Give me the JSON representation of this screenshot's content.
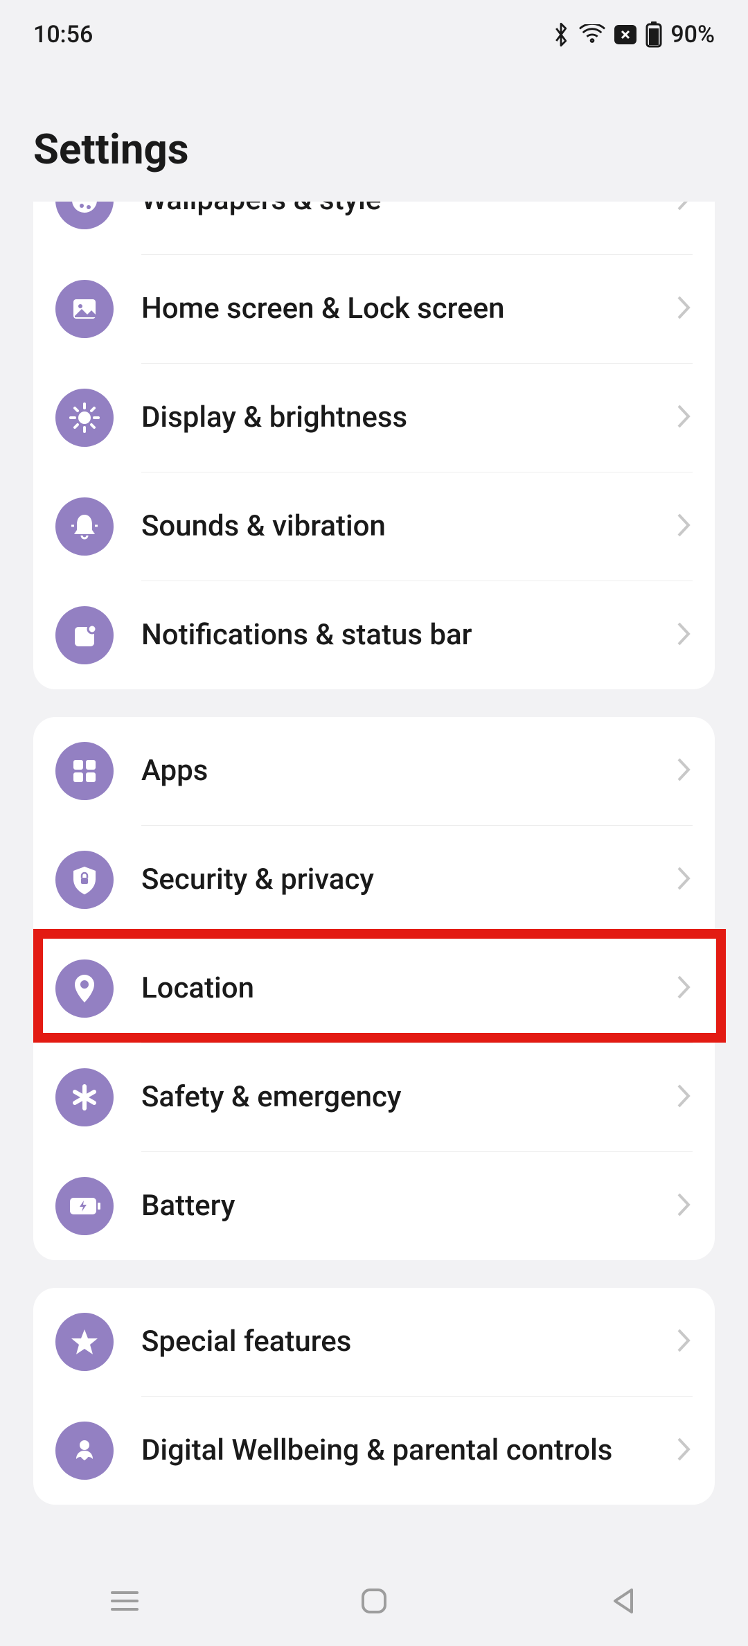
{
  "status": {
    "time": "10:56",
    "battery_text": "90%"
  },
  "header": {
    "title": "Settings"
  },
  "groups": [
    {
      "items": [
        {
          "id": "wallpapers",
          "label": "Wallpapers & style",
          "icon": "palette"
        },
        {
          "id": "home-lock",
          "label": "Home screen & Lock screen",
          "icon": "image"
        },
        {
          "id": "display",
          "label": "Display & brightness",
          "icon": "sun"
        },
        {
          "id": "sounds",
          "label": "Sounds & vibration",
          "icon": "bell"
        },
        {
          "id": "notifications",
          "label": "Notifications & status bar",
          "icon": "notif"
        }
      ]
    },
    {
      "items": [
        {
          "id": "apps",
          "label": "Apps",
          "icon": "grid",
          "highlighted": true
        },
        {
          "id": "security",
          "label": "Security & privacy",
          "icon": "shield"
        },
        {
          "id": "location",
          "label": "Location",
          "icon": "pin"
        },
        {
          "id": "safety",
          "label": "Safety & emergency",
          "icon": "asterisk"
        },
        {
          "id": "battery",
          "label": "Battery",
          "icon": "battery"
        }
      ]
    },
    {
      "items": [
        {
          "id": "special",
          "label": "Special features",
          "icon": "star"
        },
        {
          "id": "wellbeing",
          "label": "Digital Wellbeing & parental controls",
          "icon": "heart"
        }
      ]
    }
  ],
  "accent_color": "#9380c2",
  "highlight_color": "#e31b13"
}
